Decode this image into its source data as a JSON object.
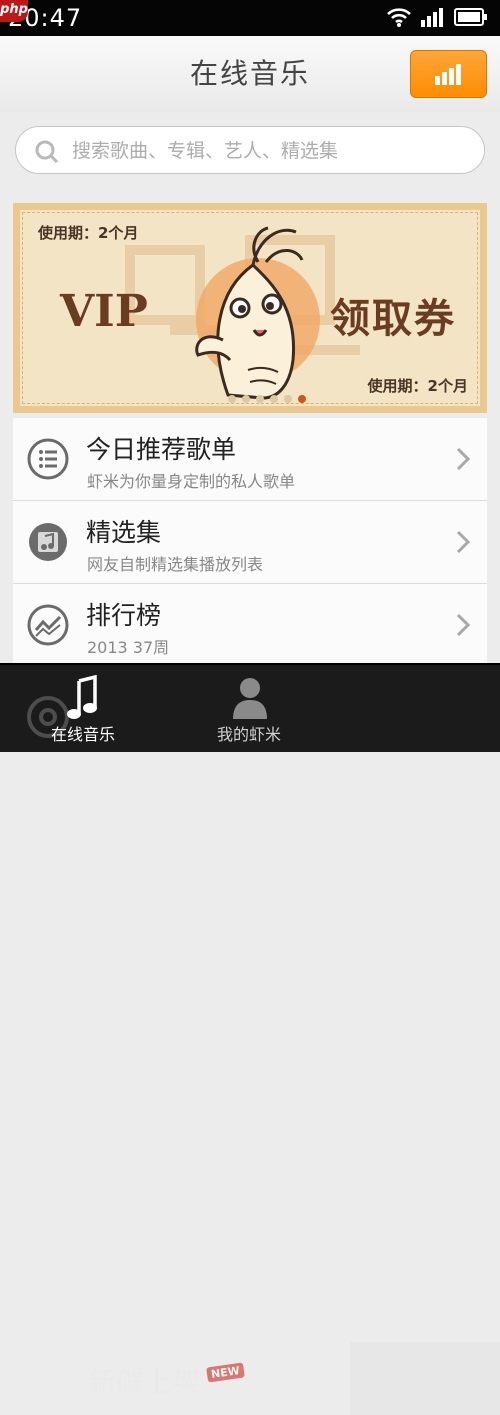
{
  "status_bar": {
    "time": "20:47",
    "badge": "php",
    "icons": [
      "wifi-icon",
      "signal-icon",
      "battery-icon"
    ]
  },
  "header": {
    "title": "在线音乐",
    "chart_button_icon": "bar-chart-icon",
    "accent_color": "#ff9a1a"
  },
  "search": {
    "placeholder": "搜索歌曲、专辑、艺人、精选集"
  },
  "banner": {
    "period_top": "使用期：2个月",
    "vip": "VIP",
    "coupon": "领取券",
    "period_bottom": "使用期：2个月",
    "slides": 6,
    "active_slide": 6
  },
  "list": [
    {
      "title": "今日推荐歌单",
      "subtitle": "虾米为你量身定制的私人歌单",
      "icon": "list-icon"
    },
    {
      "title": "精选集",
      "subtitle": "网友自制精选集播放列表",
      "icon": "music-note-icon"
    },
    {
      "title": "排行榜",
      "subtitle": "2013 37周",
      "icon": "trend-chart-icon"
    }
  ],
  "peek_item": {
    "title": "新碟上架",
    "badge": "NEW"
  },
  "tabs": [
    {
      "label": "在线音乐",
      "icon": "music-note-icon",
      "active": true
    },
    {
      "label": "我的虾米",
      "icon": "user-icon",
      "active": false
    }
  ]
}
